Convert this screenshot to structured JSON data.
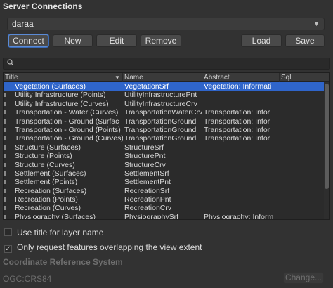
{
  "group": {
    "title": "Server Connections"
  },
  "connection": {
    "selected": "daraa"
  },
  "buttons": {
    "connect": "Connect",
    "new": "New",
    "edit": "Edit",
    "remove": "Remove",
    "load": "Load",
    "save": "Save"
  },
  "filter": {
    "icon": "search-icon",
    "value": ""
  },
  "table": {
    "columns": [
      "Title",
      "Name",
      "Abstract",
      "Sql"
    ],
    "rows": [
      {
        "title": "Vegetation (Surfaces)",
        "name": "VegetationSrf",
        "abstract": "Vegetation: Informati",
        "selected": true
      },
      {
        "title": "Utility Infrastructure (Points)",
        "name": "UtilityInfrastructurePnt",
        "abstract": ""
      },
      {
        "title": "Utility Infrastructure (Curves)",
        "name": "UtilityInfrastructureCrv",
        "abstract": ""
      },
      {
        "title": "Transportation - Water (Curves)",
        "name": "TransportationWaterCrv",
        "abstract": "Transportation: Infor"
      },
      {
        "title": "Transportation - Ground (Surfac",
        "name": "TransportationGround",
        "abstract": "Transportation: Infor"
      },
      {
        "title": "Transportation - Ground (Points)",
        "name": "TransportationGround",
        "abstract": "Transportation: Infor"
      },
      {
        "title": "Transportation - Ground (Curves)",
        "name": "TransportationGround",
        "abstract": "Transportation: Infor"
      },
      {
        "title": "Structure (Surfaces)",
        "name": "StructureSrf",
        "abstract": ""
      },
      {
        "title": "Structure (Points)",
        "name": "StructurePnt",
        "abstract": ""
      },
      {
        "title": "Structure (Curves)",
        "name": "StructureCrv",
        "abstract": ""
      },
      {
        "title": "Settlement (Surfaces)",
        "name": "SettlementSrf",
        "abstract": ""
      },
      {
        "title": "Settlement (Points)",
        "name": "SettlementPnt",
        "abstract": ""
      },
      {
        "title": "Recreation (Surfaces)",
        "name": "RecreationSrf",
        "abstract": ""
      },
      {
        "title": "Recreation (Points)",
        "name": "RecreationPnt",
        "abstract": ""
      },
      {
        "title": "Recreation (Curves)",
        "name": "RecreationCrv",
        "abstract": ""
      },
      {
        "title": "Physiography (Surfaces)",
        "name": "PhysiographySrf",
        "abstract": "Physiography: Inform"
      }
    ]
  },
  "options": {
    "use_title": "Use title for layer name",
    "use_title_checked": false,
    "overlap": "Only request features overlapping the view extent",
    "overlap_checked": true
  },
  "crs": {
    "title": "Coordinate Reference System",
    "value": "OGC:CRS84",
    "change": "Change..."
  }
}
